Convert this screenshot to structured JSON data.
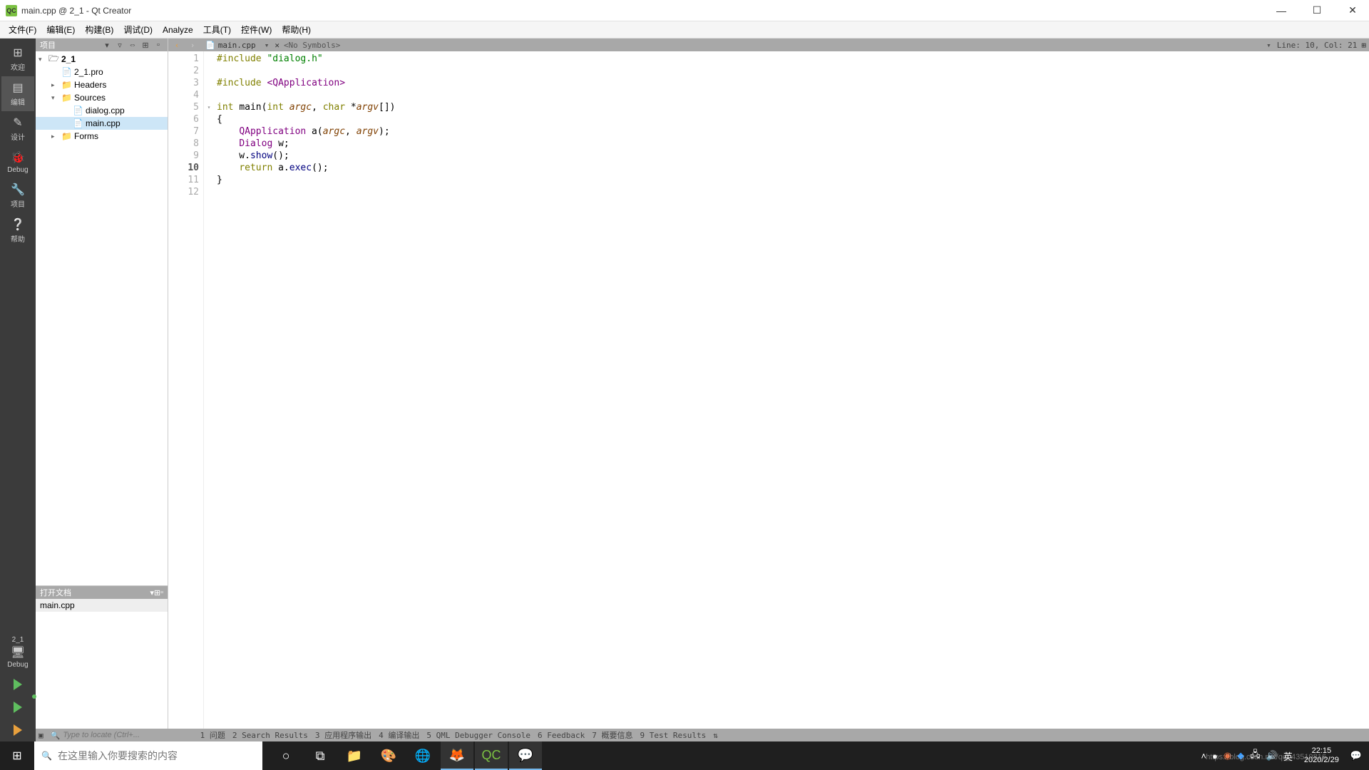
{
  "window": {
    "title": "main.cpp @ 2_1 - Qt Creator",
    "app_icon_text": "QC"
  },
  "menu": {
    "file": "文件(F)",
    "edit": "编辑(E)",
    "build": "构建(B)",
    "debug": "调试(D)",
    "analyze": "Analyze",
    "tools": "工具(T)",
    "widgets": "控件(W)",
    "help": "帮助(H)"
  },
  "sidebar": {
    "welcome": "欢迎",
    "edit": "编辑",
    "design": "设计",
    "debug": "Debug",
    "project": "项目",
    "help": "帮助",
    "target": "2_1",
    "target_mode": "Debug"
  },
  "project_panel": {
    "header": "项目",
    "tree": {
      "root": "2_1",
      "pro": "2_1.pro",
      "headers": "Headers",
      "sources": "Sources",
      "dialog_cpp": "dialog.cpp",
      "main_cpp": "main.cpp",
      "forms": "Forms"
    }
  },
  "open_docs": {
    "header": "打开文档",
    "items": [
      "main.cpp"
    ]
  },
  "editor": {
    "toolbar": {
      "filename": "main.cpp",
      "symbols": "<No Symbols>",
      "cursor": "Line: 10, Col: 21"
    },
    "lines": [
      {
        "n": 1,
        "tokens": [
          [
            "kw",
            "#include "
          ],
          [
            "str",
            "\"dialog.h\""
          ]
        ]
      },
      {
        "n": 2,
        "tokens": []
      },
      {
        "n": 3,
        "tokens": [
          [
            "kw",
            "#include "
          ],
          [
            "type",
            "<QApplication>"
          ]
        ]
      },
      {
        "n": 4,
        "tokens": []
      },
      {
        "n": 5,
        "tokens": [
          [
            "kw",
            "int"
          ],
          [
            "",
            " "
          ],
          [
            "",
            "main("
          ],
          [
            "kw",
            "int"
          ],
          [
            "",
            " "
          ],
          [
            "arg",
            "argc"
          ],
          [
            "",
            ", "
          ],
          [
            "kw",
            "char"
          ],
          [
            "",
            " *"
          ],
          [
            "arg",
            "argv"
          ],
          [
            "",
            "[])"
          ]
        ],
        "fold": true
      },
      {
        "n": 6,
        "tokens": [
          [
            "",
            "{"
          ]
        ]
      },
      {
        "n": 7,
        "tokens": [
          [
            "",
            "    "
          ],
          [
            "type",
            "QApplication"
          ],
          [
            "",
            " a("
          ],
          [
            "arg",
            "argc"
          ],
          [
            "",
            ", "
          ],
          [
            "arg",
            "argv"
          ],
          [
            "",
            ");"
          ]
        ]
      },
      {
        "n": 8,
        "tokens": [
          [
            "",
            "    "
          ],
          [
            "type",
            "Dialog"
          ],
          [
            "",
            " w;"
          ]
        ]
      },
      {
        "n": 9,
        "tokens": [
          [
            "",
            "    w."
          ],
          [
            "func",
            "show"
          ],
          [
            "",
            "();"
          ]
        ]
      },
      {
        "n": 10,
        "tokens": [
          [
            "",
            "    "
          ],
          [
            "kw",
            "return"
          ],
          [
            "",
            " a."
          ],
          [
            "func",
            "exec"
          ],
          [
            "",
            "();"
          ]
        ],
        "active": true
      },
      {
        "n": 11,
        "tokens": [
          [
            "",
            "}"
          ]
        ]
      },
      {
        "n": 12,
        "tokens": []
      }
    ]
  },
  "bottom_tabs": {
    "locator_placeholder": "Type to locate (Ctrl+...",
    "t1": "1 问题",
    "t2": "2 Search Results",
    "t3": "3 应用程序输出",
    "t4": "4 编译输出",
    "t5": "5 QML Debugger Console",
    "t6": "6 Feedback",
    "t7": "7 概要信息",
    "t9": "9 Test Results"
  },
  "taskbar": {
    "search_placeholder": "在这里输入你要搜索的内容",
    "ime": "英",
    "time": "22:15",
    "date": "2020/2/29",
    "watermark": "https://blog.csdn.net/qq_43519816"
  }
}
